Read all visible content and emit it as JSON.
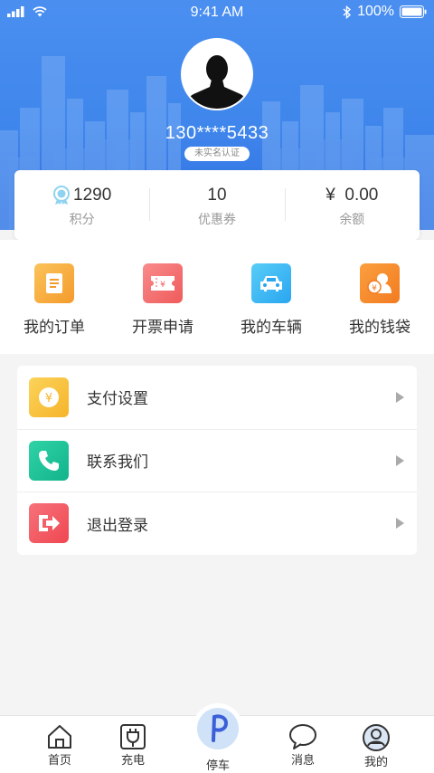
{
  "status": {
    "time": "9:41 AM",
    "battery": "100%"
  },
  "profile": {
    "phone": "130****5433",
    "verify_status": "未实名认证"
  },
  "stats": [
    {
      "value": "1290",
      "label": "积分",
      "icon": "medal-icon"
    },
    {
      "value": "10",
      "label": "优惠券"
    },
    {
      "value": "¥  0.00",
      "label": "余额"
    }
  ],
  "quick": [
    {
      "label": "我的订单",
      "icon": "order-icon",
      "color": "#f6a93b"
    },
    {
      "label": "开票申请",
      "icon": "invoice-icon",
      "color": "#f36b6b"
    },
    {
      "label": "我的车辆",
      "icon": "car-icon",
      "color": "#3cb9f4"
    },
    {
      "label": "我的钱袋",
      "icon": "wallet-icon",
      "color": "#f68a2c"
    }
  ],
  "menu": [
    {
      "label": "支付设置",
      "icon": "payment-icon",
      "color": "#f8c33a"
    },
    {
      "label": "联系我们",
      "icon": "phone-icon",
      "color": "#1fc19a"
    },
    {
      "label": "退出登录",
      "icon": "logout-icon",
      "color": "#f2565f"
    }
  ],
  "tabs": [
    {
      "label": "首页",
      "icon": "home-icon"
    },
    {
      "label": "充电",
      "icon": "charge-icon"
    },
    {
      "label": "停车",
      "icon": "parking-icon",
      "accent": "#3a5fd8"
    },
    {
      "label": "消息",
      "icon": "message-icon"
    },
    {
      "label": "我的",
      "icon": "profile-icon"
    }
  ]
}
